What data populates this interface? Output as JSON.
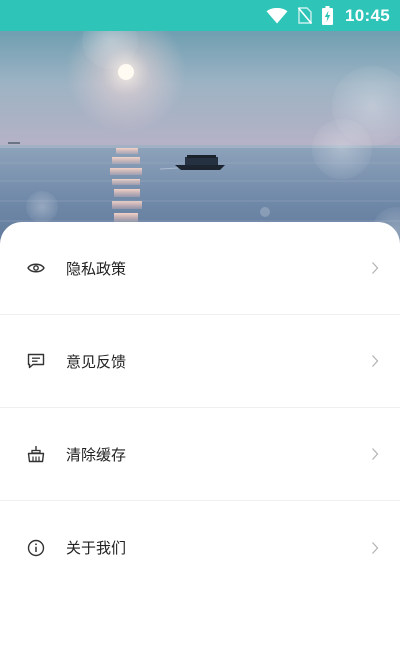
{
  "status_bar": {
    "time": "10:45",
    "icons": [
      "wifi-icon",
      "no-sim-icon",
      "battery-charging-icon"
    ],
    "background": "#2ec4b8"
  },
  "hero": {
    "image": "sunset-sea-boat-photo"
  },
  "menu": {
    "items": [
      {
        "label": "隐私政策",
        "icon": "eye-icon"
      },
      {
        "label": "意见反馈",
        "icon": "message-icon"
      },
      {
        "label": "清除缓存",
        "icon": "basket-icon"
      },
      {
        "label": "关于我们",
        "icon": "info-icon"
      }
    ]
  }
}
